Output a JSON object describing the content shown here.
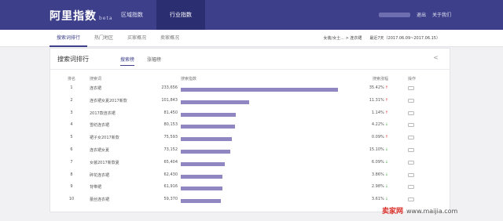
{
  "header": {
    "logo": "阿里指数",
    "beta": "beta",
    "nav": [
      "区域指数",
      "行业指数"
    ],
    "user": [
      "退出",
      "关于我们"
    ]
  },
  "subnav": {
    "tabs": [
      "搜索词排行",
      "热门地区",
      "买家概况",
      "卖家概况"
    ],
    "category": "女装/女士... > 连衣裙",
    "daterange": "最近7天（2017.06.09~2017.06.15）"
  },
  "card": {
    "title": "搜索词排行",
    "tabs": [
      "搜索榜",
      "涨幅榜"
    ],
    "headers": {
      "rank": "排名",
      "word": "搜索词",
      "index": "搜索指数",
      "pct": "搜索涨幅",
      "act": "操作"
    },
    "rows": [
      {
        "rank": "1",
        "word": "连衣裙",
        "value": "233,656",
        "pct": "35.42%",
        "dir": "up",
        "ratio": 1.0
      },
      {
        "rank": "2",
        "word": "连衣裙女夏2017新款",
        "value": "101,843",
        "pct": "11.31%",
        "dir": "up",
        "ratio": 0.436
      },
      {
        "rank": "3",
        "word": "2017款连衣裙",
        "value": "81,450",
        "pct": "1.14%",
        "dir": "up",
        "ratio": 0.349
      },
      {
        "rank": "4",
        "word": "雪纺连衣裙",
        "value": "80,153",
        "pct": "4.22%",
        "dir": "down",
        "ratio": 0.343
      },
      {
        "rank": "5",
        "word": "裙子女2017新款",
        "value": "75,593",
        "pct": "0.09%",
        "dir": "up",
        "ratio": 0.324
      },
      {
        "rank": "6",
        "word": "连衣裙女夏",
        "value": "73,152",
        "pct": "15.10%",
        "dir": "down",
        "ratio": 0.313
      },
      {
        "rank": "7",
        "word": "女装2017新款夏",
        "value": "65,404",
        "pct": "6.09%",
        "dir": "down",
        "ratio": 0.28
      },
      {
        "rank": "8",
        "word": "碎花连衣裙",
        "value": "62,430",
        "pct": "3.86%",
        "dir": "down",
        "ratio": 0.267
      },
      {
        "rank": "9",
        "word": "背带裙",
        "value": "61,916",
        "pct": "2.98%",
        "dir": "down",
        "ratio": 0.265
      },
      {
        "rank": "10",
        "word": "蕾丝连衣裙",
        "value": "59,370",
        "pct": "3.61%",
        "dir": "down",
        "ratio": 0.254
      }
    ]
  },
  "watermark": {
    "brand": "卖家网",
    "url": "www.maijia.com"
  },
  "colors": {
    "primary": "#3d3f8a",
    "bar": "#8f86c2",
    "up": "#d9302a",
    "down": "#4caf50"
  }
}
